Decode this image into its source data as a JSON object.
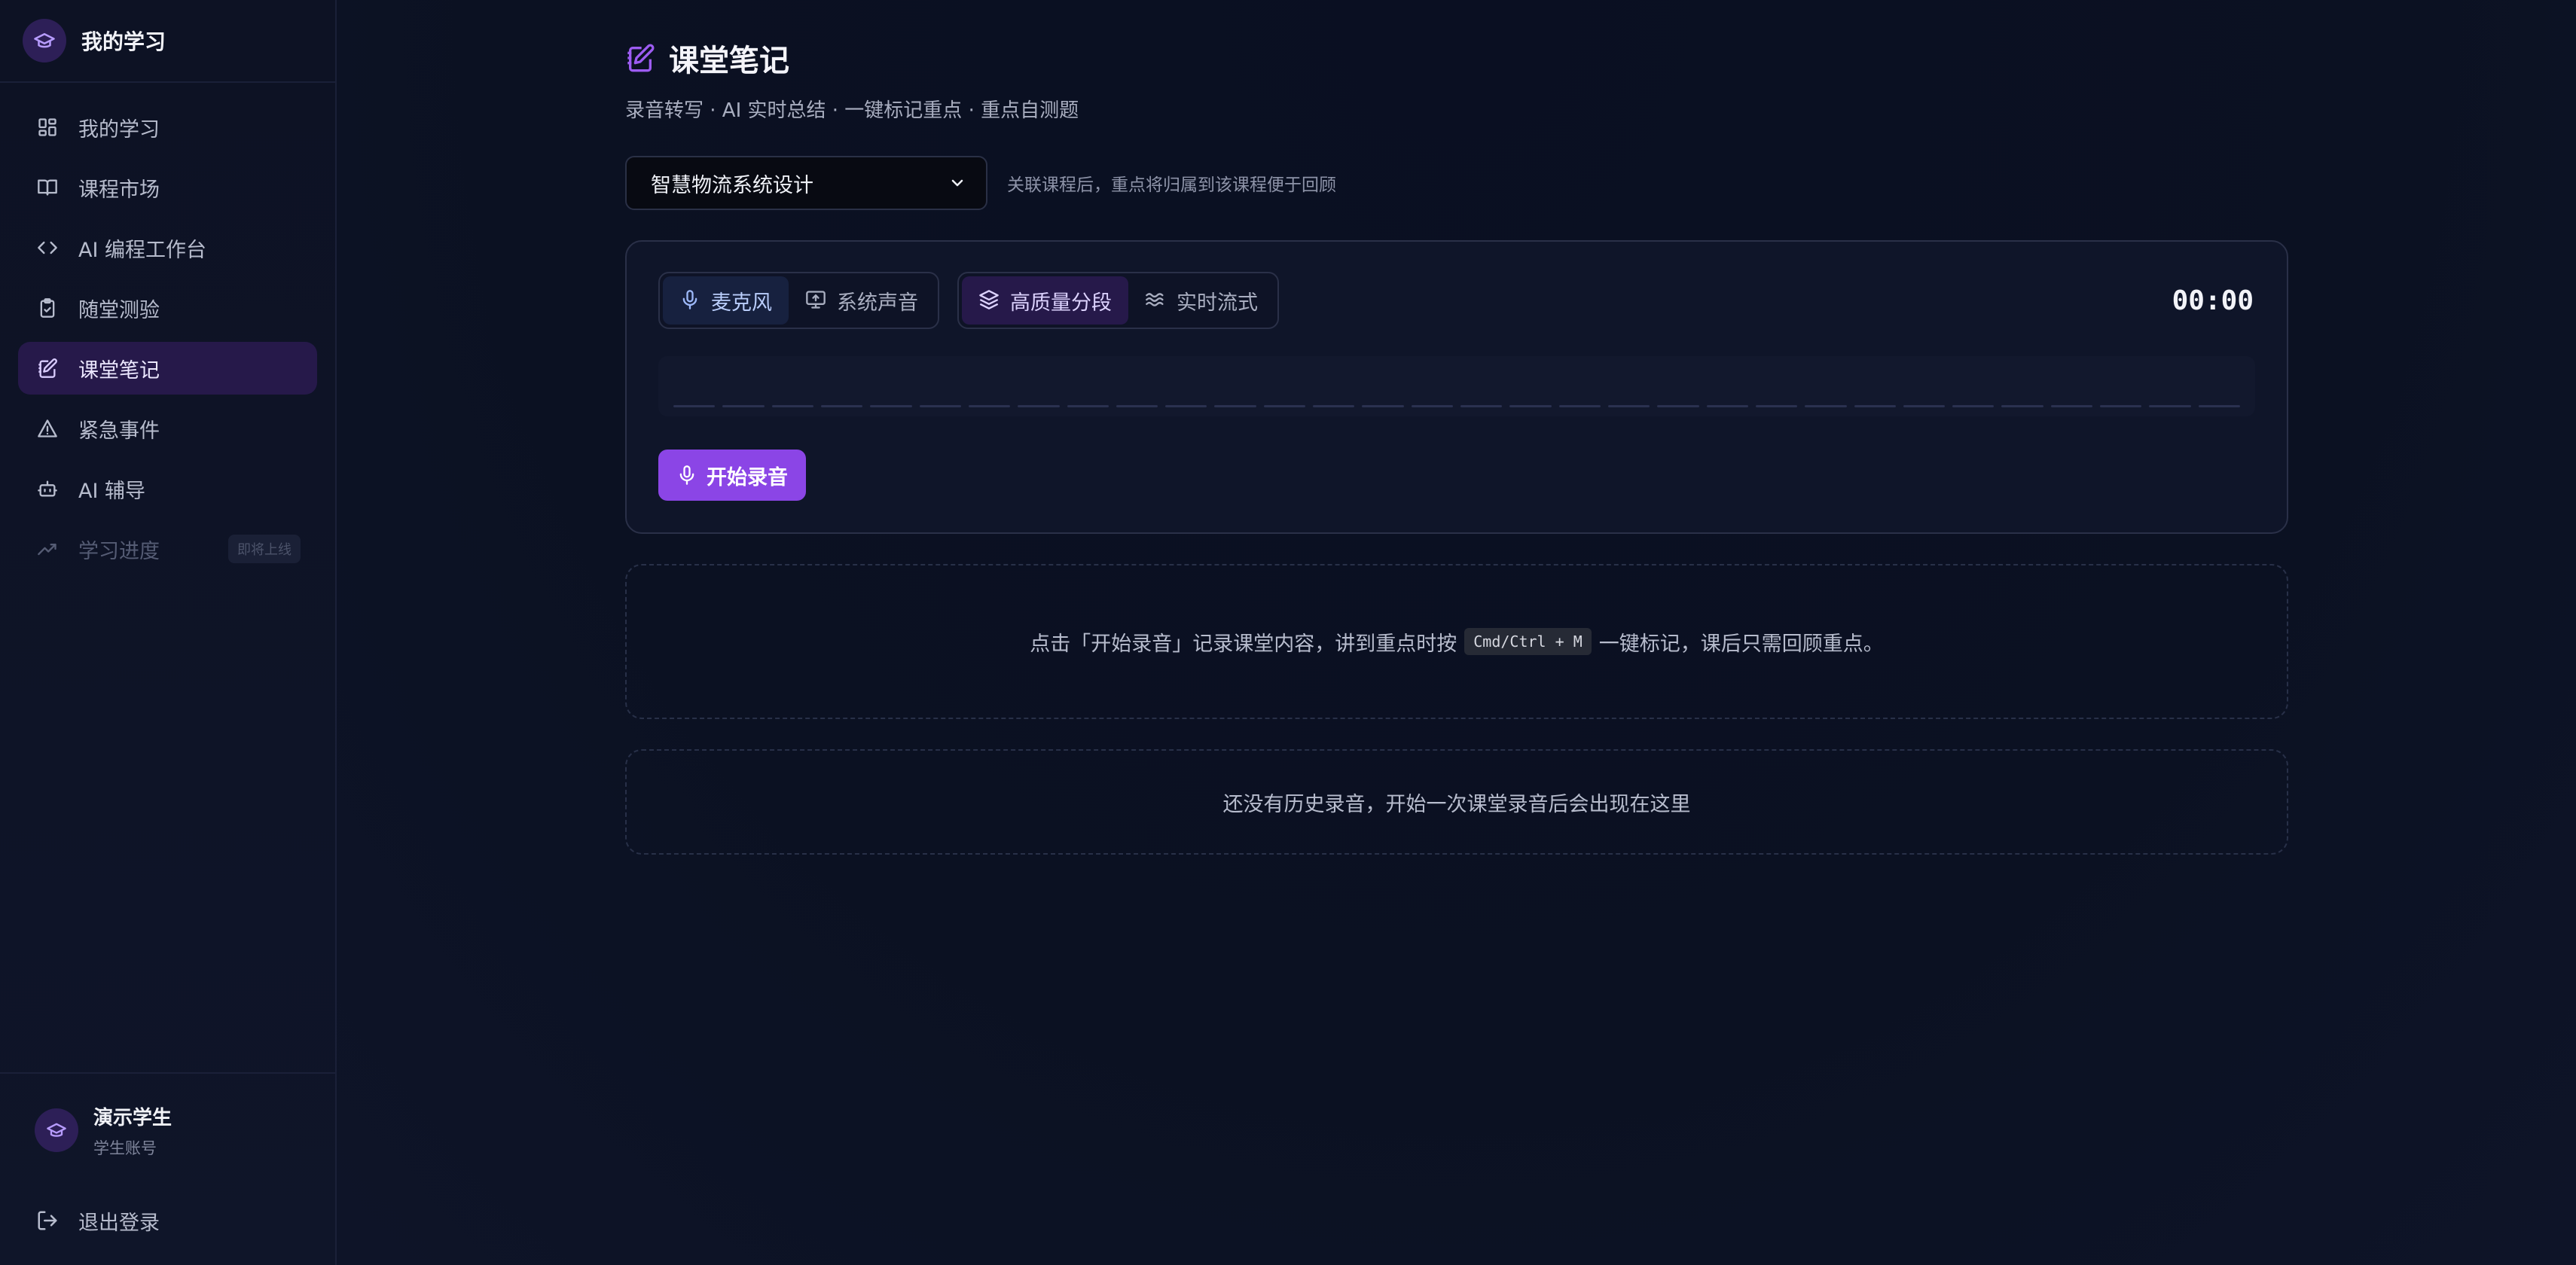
{
  "sidebar": {
    "brand": "我的学习",
    "items": [
      {
        "label": "我的学习",
        "icon": "dashboard-icon"
      },
      {
        "label": "课程市场",
        "icon": "book-icon"
      },
      {
        "label": "AI 编程工作台",
        "icon": "code-icon"
      },
      {
        "label": "随堂测验",
        "icon": "clipboard-check-icon"
      },
      {
        "label": "课堂笔记",
        "icon": "notebook-pen-icon",
        "active": true
      },
      {
        "label": "紧急事件",
        "icon": "warning-icon"
      },
      {
        "label": "AI 辅导",
        "icon": "robot-icon"
      },
      {
        "label": "学习进度",
        "icon": "trend-icon",
        "disabled": true,
        "badge": "即将上线"
      }
    ],
    "user": {
      "name": "演示学生",
      "role": "学生账号"
    },
    "logout": "退出登录"
  },
  "main": {
    "title": "课堂笔记",
    "subtitle": "录音转写 · AI 实时总结 · 一键标记重点 · 重点自测题",
    "course_select": {
      "value": "智慧物流系统设计"
    },
    "course_hint": "关联课程后，重点将归属到该课程便于回顾",
    "recorder": {
      "source_mic": "麦克风",
      "source_system": "系统声音",
      "mode_hq": "高质量分段",
      "mode_stream": "实时流式",
      "timer": "00:00",
      "start_label": "开始录音"
    },
    "tip": {
      "before": "点击「开始录音」记录课堂内容，讲到重点时按",
      "kbd": "Cmd/Ctrl + M",
      "after": "一键标记，课后只需回顾重点。"
    },
    "history_empty": "还没有历史录音，开始一次课堂录音后会出现在这里"
  },
  "colors": {
    "accent": "#8b45e6",
    "active_nav_bg": "#26194a",
    "mic_active_text": "#b9cdfb"
  }
}
